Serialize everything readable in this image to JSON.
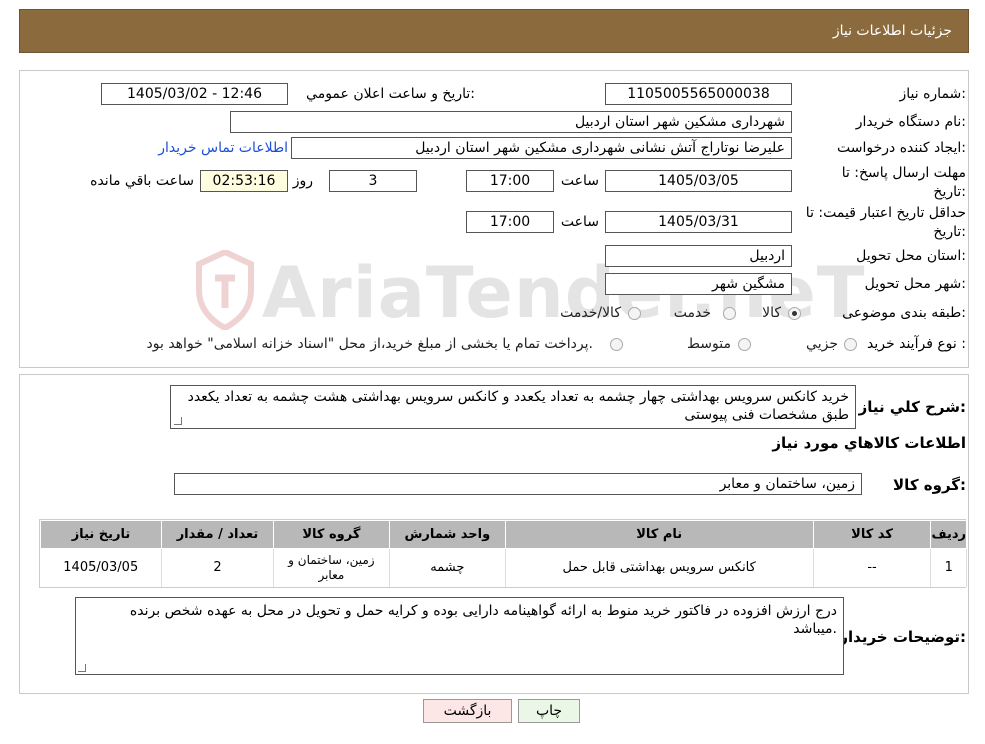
{
  "header": {
    "title": "جزئیات اطلاعات نیاز"
  },
  "watermark": {
    "text": "AriaTender.neT"
  },
  "form": {
    "need_number_label": "شماره نیاز:",
    "need_number": "1105005565000038",
    "announce_label": "تاریخ و ساعت اعلان عمومي:",
    "announce_value": "1405/03/02 - 12:46",
    "buyer_org_label": "نام دستگاه خريدار:",
    "buyer_org": "شهرداری مشکین شهر استان اردبیل",
    "creator_label": "ايجاد کننده درخواست:",
    "creator": "علیرضا نوتاراج آتش نشانی شهرداری مشکین شهر استان اردبیل",
    "contact_link": "اطلاعات تماس خريدار",
    "deadline_label_1": "مهلت ارسال پاسخ: تا",
    "deadline_label_2": "تاريخ:",
    "deadline_date": "1405/03/05",
    "time_label": "ساعت",
    "deadline_time": "17:00",
    "days_value": "3",
    "days_label": "روز و",
    "remaining_time": "02:53:16",
    "remaining_label": "ساعت باقي مانده",
    "validity_label_1": "حداقل تاريخ اعتبار قيمت: تا",
    "validity_label_2": "تاريخ:",
    "validity_date": "1405/03/31",
    "validity_time": "17:00",
    "province_label": "استان محل تحويل:",
    "province": "اردبیل",
    "city_label": "شهر محل تحويل:",
    "city": "مشگین شهر",
    "category_label": "طبقه بندی موضوعی:",
    "category_options": [
      "کالا",
      "خدمت",
      "کالا/خدمت"
    ],
    "category_selected": "کالا",
    "process_label": "نوع فرآيند خريد :",
    "process_options": [
      "جزيي",
      "متوسط"
    ],
    "process_note": "پرداخت تمام يا بخشی از مبلغ خريد،از محل \"اسناد خزانه اسلامی\" خواهد بود."
  },
  "description": {
    "label": "شرح کلي نياز:",
    "text": "خرید کانکس سرویس بهداشتی چهار چشمه  به تعداد  یکعدد و کانکس  سرویس بهداشتی  هشت چشمه به تعداد یکعدد طبق مشخصات فنی پیوستی"
  },
  "goods_section": {
    "title": "اطلاعات کالاهاي مورد نياز",
    "group_label": "گروه کالا:",
    "group_value": "زمین، ساختمان و معابر"
  },
  "table": {
    "headers": [
      "رديف",
      "کد کالا",
      "نام کالا",
      "واحد شمارش",
      "گروه کالا",
      "تعداد / مقدار",
      "تاريخ نياز"
    ],
    "rows": [
      [
        "1",
        "--",
        "کانکس سرویس بهداشتی قابل حمل",
        "چشمه",
        "زمین، ساختمان و معابر",
        "2",
        "1405/03/05"
      ]
    ]
  },
  "buyer_notes": {
    "label": "توضيحات خريدار:",
    "text": "درج ارزش افزوده در فاکتور خرید منوط به ارائه گواهینامه دارایی بوده و کرایه حمل و تحویل در محل به عهده شخص برنده میباشد."
  },
  "buttons": {
    "print": "چاپ",
    "back": "بازگشت"
  },
  "colors": {
    "header_bg": "#8b6b3e",
    "table_header_bg": "#b8b8b8",
    "link": "#1a4fd6",
    "back_btn_bg": "#fde6e6",
    "print_btn_bg": "#eaf6e6"
  }
}
